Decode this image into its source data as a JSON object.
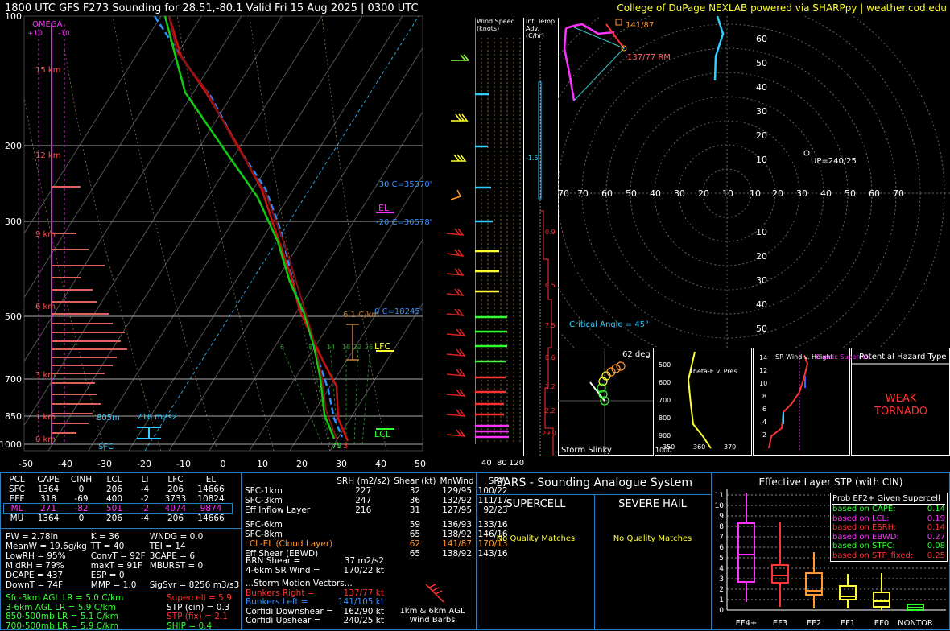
{
  "header": {
    "title": "1800 UTC GFS F273 Sounding for 28.51,-80.1 Valid  Fri 15 Aug 2025 | 0300 UTC",
    "credit": "College of DuPage NEXLAB powered via SHARPpy | weather.cod.edu",
    "credit_color": "#ffff33"
  },
  "skewt": {
    "pressure_labels": [
      "100",
      "200",
      "300",
      "500",
      "700",
      "850",
      "1000"
    ],
    "temp_labels": [
      "-50",
      "-40",
      "-30",
      "-20",
      "-10",
      "0",
      "10",
      "20",
      "30",
      "40",
      "50"
    ],
    "height_labels": [
      "15 km",
      "12 km",
      "9 km",
      "6 km",
      "3 km",
      "1 km",
      "0 km"
    ],
    "omega_label": "OMEGA",
    "omega_ticks": [
      "+10",
      "-10"
    ],
    "annotations": {
      "c30": "-30 C=35370'",
      "el": "EL",
      "c20": "-20 C=30578'",
      "lapse": "6.1 C/km",
      "c0": "0 C=18245'",
      "lfc": "LFC",
      "lcl": "LCL",
      "sfc": "SFC",
      "h805": "805m",
      "srh": "216 m2s2",
      "t79": "79",
      "t3": "3"
    },
    "mix_labels": [
      "6",
      "8",
      "14",
      "18",
      "22",
      "26"
    ]
  },
  "windspeed": {
    "title": "Wind Speed (knots)",
    "ticks": [
      "40",
      "80",
      "120"
    ]
  },
  "tempadv": {
    "title": "Inf. Temp. Adv. (C/hr)",
    "values": [
      "-1.5",
      "0.9",
      "0.5",
      "7.5",
      "0.6",
      "1.2",
      "2.2",
      "29.0"
    ]
  },
  "hodograph": {
    "rings_right": [
      "60",
      "50",
      "40",
      "30",
      "20",
      "10"
    ],
    "ring_x_left": [
      "70",
      "60",
      "50",
      "40",
      "30",
      "20",
      "10"
    ],
    "ring_x_right": [
      "10",
      "20",
      "30",
      "40",
      "50",
      "60",
      "70"
    ],
    "rings_low": [
      "10",
      "20",
      "30",
      "40",
      "50",
      "60"
    ],
    "lm": "141/87",
    "rm": "137/77 RM",
    "up": "UP=240/25",
    "critical": "Critical Angle = 45°"
  },
  "slinky": {
    "angle": "62 deg",
    "label": "Storm Slinky"
  },
  "thetae": {
    "title": "Theta-E v. Pres",
    "p": [
      "500",
      "600",
      "700",
      "800",
      "900",
      "1000"
    ],
    "x": [
      "350",
      "360",
      "370"
    ]
  },
  "srwind": {
    "title": "SR Wind v. Height",
    "classic": "Classic Supercell",
    "y": [
      "14",
      "12",
      "10",
      "8",
      "6",
      "4",
      "2"
    ]
  },
  "hazard": {
    "title": "Potential Hazard Type",
    "value": "WEAK\nTORNADO",
    "color": "#ff3333"
  },
  "parcels": {
    "headers": [
      "PCL",
      "CAPE",
      "CINH",
      "LCL",
      "LI",
      "LFC",
      "EL"
    ],
    "rows": [
      [
        "SFC",
        "1364",
        "0",
        "206",
        "-4",
        "206",
        "14666"
      ],
      [
        "EFF",
        "318",
        "-69",
        "400",
        "-2",
        "3733",
        "10824"
      ],
      [
        "ML",
        "271",
        "-82",
        "501",
        "-2",
        "4074",
        "9874"
      ],
      [
        "MU",
        "1364",
        "0",
        "206",
        "-4",
        "206",
        "14666"
      ]
    ]
  },
  "indices": [
    [
      "PW = 2.78in",
      "K = 36",
      "WNDG = 0.0"
    ],
    [
      "MeanW = 19.6g/kg",
      "TT = 40",
      "TEI = 14"
    ],
    [
      "LowRH = 95%",
      "ConvT = 92F",
      "3CAPE = 6"
    ],
    [
      "MidRH = 79%",
      "maxT = 91F",
      "MBURST = 0"
    ],
    [
      "DCAPE = 437",
      "ESP = 0",
      ""
    ],
    [
      "DownT = 74F",
      "MMP = 1.0",
      "SigSvr = 8256 m3/s3"
    ]
  ],
  "lapse_rates": [
    "Sfc-3km AGL LR = 5.0 C/km",
    "3-6km AGL LR = 5.9 C/km",
    "850-500mb LR = 5.1 C/km",
    "700-500mb LR = 5.9 C/km"
  ],
  "composite": [
    "Supercell = 5.9",
    "STP (cin) = 0.3",
    "STP (fix) = 2.1",
    "SHIP = 0.4"
  ],
  "kinematics": {
    "headers": [
      "SRH (m2/s2)",
      "Shear (kt)",
      "MnWind",
      "SRW"
    ],
    "rows": [
      [
        "SFC-1km",
        "227",
        "32",
        "129/95",
        "100/22"
      ],
      [
        "SFC-3km",
        "247",
        "36",
        "132/92",
        "111/17"
      ],
      [
        "Eff Inflow Layer",
        "216",
        "31",
        "127/95",
        "92/23"
      ],
      [
        "",
        "",
        "",
        "",
        ""
      ],
      [
        "SFC-6km",
        "59",
        "136/93",
        "133/16",
        ""
      ],
      [
        "SFC-8km",
        "65",
        "138/92",
        "146/16",
        ""
      ],
      [
        "LCL-EL (Cloud Layer)",
        "62",
        "141/87",
        "170/13",
        ""
      ],
      [
        "Eff Shear (EBWD)",
        "65",
        "138/92",
        "143/16",
        ""
      ]
    ],
    "brn": [
      "BRN Shear =",
      "37 m2/s2"
    ],
    "srw46": [
      "4-6km SR Wind =",
      "170/22 kt"
    ],
    "motion_title": "...Storm Motion Vectors...",
    "motion": [
      [
        "Bunkers Right =",
        "137/77 kt"
      ],
      [
        "Bunkers Left =",
        "141/105 kt"
      ],
      [
        "Corfidi Downshear =",
        "162/90 kt"
      ],
      [
        "Corfidi Upshear =",
        "240/25 kt"
      ]
    ],
    "barbs": "1km & 6km AGL Wind Barbs"
  },
  "sars": {
    "title": "SARS - Sounding Analogue System",
    "supercell": "SUPERCELL",
    "hail": "SEVERE HAIL",
    "nomatch": "No Quality Matches"
  },
  "stp": {
    "title": "Effective Layer STP (with CIN)",
    "y": [
      "11",
      "10",
      "9",
      "8",
      "7",
      "6",
      "5",
      "4",
      "3",
      "2",
      "1",
      "0"
    ],
    "cats": [
      "EF4+",
      "EF3",
      "EF2",
      "EF1",
      "EF0",
      "NONTOR"
    ],
    "prob_title": "Prob EF2+ Given Supercell",
    "probs": [
      [
        "based on CAPE:",
        "0.14",
        "#33ff33"
      ],
      [
        "based on LCL:",
        "0.19",
        "#ff33ff"
      ],
      [
        "based on ESRH:",
        "0.14",
        "#ff3333"
      ],
      [
        "based on EBWD:",
        "0.27",
        "#ff33ff"
      ],
      [
        "based on STPC:",
        "0.08",
        "#33ff33"
      ],
      [
        "based on STP_fixed:",
        "0.25",
        "#ff3333"
      ]
    ]
  }
}
